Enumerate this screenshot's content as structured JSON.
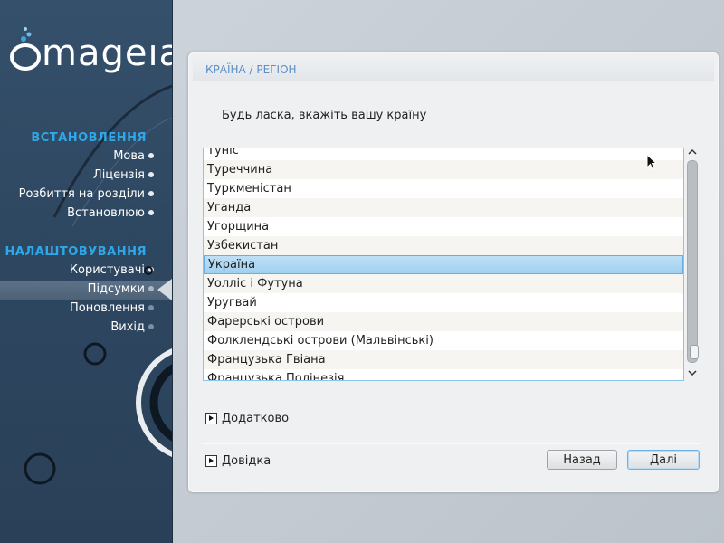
{
  "brand": {
    "logo_text": "mageıa"
  },
  "sidebar": {
    "install_title": "ВСТАНОВЛЕННЯ",
    "install_items": [
      {
        "label": "Мова"
      },
      {
        "label": "Ліцензія"
      },
      {
        "label": "Розбиття на розділи"
      },
      {
        "label": "Встановлюю"
      }
    ],
    "config_title": "НАЛАШТОВУВАННЯ",
    "config_items": [
      {
        "label": "Користувачі"
      },
      {
        "label": "Підсумки"
      },
      {
        "label": "Поновлення"
      },
      {
        "label": "Вихід"
      }
    ],
    "active_item": "Підсумки"
  },
  "panel": {
    "title": "КРАЇНА / РЕГІОН",
    "prompt": "Будь ласка, вкажіть вашу країну",
    "countries": [
      "Туніс",
      "Туреччина",
      "Туркменістан",
      "Уганда",
      "Угорщина",
      "Узбекистан",
      "Україна",
      "Уолліс і Футуна",
      "Уругвай",
      "Фарерські острови",
      "Фолклендські острови (Мальвінські)",
      "Французька Гвіана",
      "Французька Полінезія"
    ],
    "selected_country": "Україна",
    "advanced_label": "Додатково",
    "help_label": "Довідка",
    "back_button": "Назад",
    "next_button": "Далі"
  },
  "colors": {
    "accent": "#2fa7e8",
    "sidebar_bg": "#2e4761",
    "selection": "#aad6f2",
    "title_text": "#5a8fc7"
  }
}
